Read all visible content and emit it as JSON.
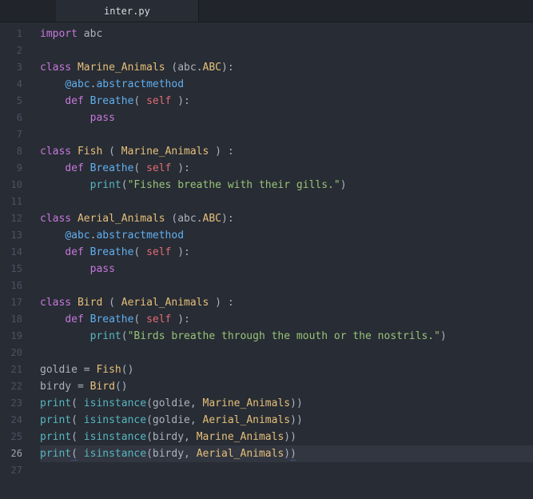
{
  "tab": {
    "filename": "inter.py"
  },
  "gutter": {
    "count": 27
  },
  "active_line": 26,
  "tokens": {
    "import": "import",
    "class": "class",
    "def": "def",
    "pass": "pass",
    "self": "self",
    "abc_mod": "abc",
    "ABC": "ABC",
    "abstractmethod": "abstractmethod",
    "Marine_Animals": "Marine_Animals",
    "Aerial_Animals": "Aerial_Animals",
    "Fish": "Fish",
    "Bird": "Bird",
    "Breathe": "Breathe",
    "goldie": "goldie",
    "birdy": "birdy",
    "print": "print",
    "isinstance": "isinstance",
    "str_fish": "\"Fishes breathe with their gills.\"",
    "str_bird": "\"Birds breathe through the mouth or the nostrils.\"",
    "at": "@",
    "dot": ".",
    "comma": ",",
    "lparen": "(",
    "rparen": ")",
    "colon": ":",
    "eq": "=",
    "sp": " ",
    "sp2": "  ",
    "indent1": "    ",
    "indent2": "        "
  }
}
